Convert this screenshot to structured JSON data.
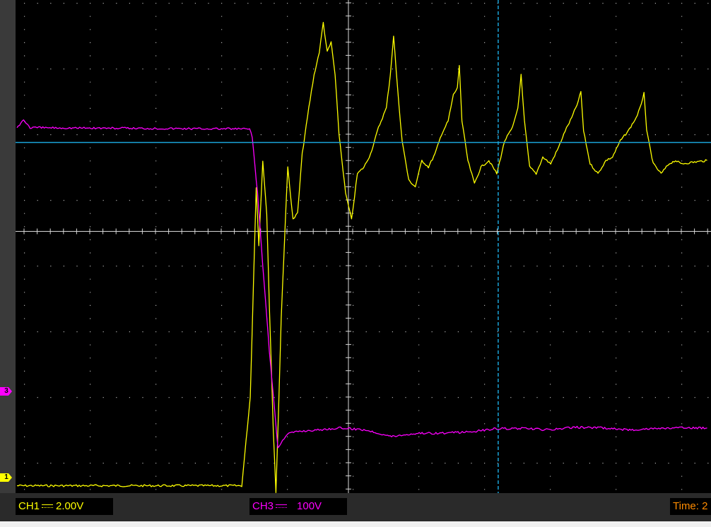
{
  "colors": {
    "ch1": "#ffff00",
    "ch3": "#ff00ff",
    "cursor": "#1aa3d9",
    "time_text": "#ff8c00",
    "grid": "#c8c8c8"
  },
  "channels": [
    {
      "marker": "1",
      "label": "CH1",
      "coupling_icon": "dc-coupling-icon",
      "scale": "2.00V"
    },
    {
      "marker": "3",
      "label": "CH3",
      "coupling_icon": "dc-coupling-icon",
      "scale": "100V"
    }
  ],
  "time_readout": "Time: 2",
  "display": {
    "divisions_x": 10.5,
    "divisions_y": 7.5,
    "cursor_vertical_div": 7.3,
    "cursor_horizontal_div": 2.2
  },
  "chart_data": {
    "type": "line",
    "grid": true,
    "series": [
      {
        "name": "CH1",
        "points": [
          [
            0,
            7.35
          ],
          [
            3.42,
            7.35
          ],
          [
            3.55,
            6.0
          ],
          [
            3.6,
            4.2
          ],
          [
            3.64,
            2.8
          ],
          [
            3.68,
            3.7
          ],
          [
            3.74,
            2.4
          ],
          [
            3.8,
            3.2
          ],
          [
            3.84,
            4.6
          ],
          [
            3.9,
            6.5
          ],
          [
            3.94,
            7.45
          ],
          [
            3.98,
            6.2
          ],
          [
            4.02,
            4.8
          ],
          [
            4.08,
            3.4
          ],
          [
            4.12,
            2.5
          ],
          [
            4.2,
            3.3
          ],
          [
            4.27,
            3.2
          ],
          [
            4.34,
            2.3
          ],
          [
            4.44,
            1.6
          ],
          [
            4.52,
            1.1
          ],
          [
            4.6,
            0.75
          ],
          [
            4.66,
            0.3
          ],
          [
            4.72,
            0.75
          ],
          [
            4.78,
            0.6
          ],
          [
            4.84,
            1.1
          ],
          [
            4.9,
            2.0
          ],
          [
            5.0,
            2.9
          ],
          [
            5.09,
            3.3
          ],
          [
            5.18,
            2.6
          ],
          [
            5.28,
            2.5
          ],
          [
            5.38,
            2.3
          ],
          [
            5.5,
            1.9
          ],
          [
            5.62,
            1.6
          ],
          [
            5.68,
            1.1
          ],
          [
            5.73,
            0.5
          ],
          [
            5.79,
            1.3
          ],
          [
            5.86,
            2.1
          ],
          [
            5.96,
            2.7
          ],
          [
            6.06,
            2.8
          ],
          [
            6.16,
            2.4
          ],
          [
            6.26,
            2.5
          ],
          [
            6.36,
            2.3
          ],
          [
            6.46,
            2.0
          ],
          [
            6.56,
            1.8
          ],
          [
            6.64,
            1.4
          ],
          [
            6.7,
            1.3
          ],
          [
            6.73,
            0.95
          ],
          [
            6.77,
            1.8
          ],
          [
            6.86,
            2.4
          ],
          [
            6.96,
            2.75
          ],
          [
            7.06,
            2.5
          ],
          [
            7.18,
            2.4
          ],
          [
            7.3,
            2.6
          ],
          [
            7.42,
            2.1
          ],
          [
            7.54,
            1.9
          ],
          [
            7.62,
            1.6
          ],
          [
            7.67,
            1.1
          ],
          [
            7.72,
            1.8
          ],
          [
            7.8,
            2.5
          ],
          [
            7.9,
            2.6
          ],
          [
            8.0,
            2.35
          ],
          [
            8.12,
            2.45
          ],
          [
            8.24,
            2.2
          ],
          [
            8.34,
            1.95
          ],
          [
            8.44,
            1.75
          ],
          [
            8.54,
            1.5
          ],
          [
            8.58,
            1.35
          ],
          [
            8.62,
            1.95
          ],
          [
            8.72,
            2.45
          ],
          [
            8.84,
            2.6
          ],
          [
            8.96,
            2.4
          ],
          [
            9.06,
            2.35
          ],
          [
            9.18,
            2.1
          ],
          [
            9.3,
            1.95
          ],
          [
            9.42,
            1.75
          ],
          [
            9.5,
            1.55
          ],
          [
            9.54,
            1.35
          ],
          [
            9.58,
            1.95
          ],
          [
            9.68,
            2.45
          ],
          [
            9.8,
            2.6
          ],
          [
            9.92,
            2.45
          ],
          [
            10.02,
            2.4
          ],
          [
            10.1,
            2.45
          ],
          [
            10.5,
            2.4
          ]
        ]
      },
      {
        "name": "CH3",
        "points": [
          [
            0,
            1.9
          ],
          [
            0.1,
            1.78
          ],
          [
            0.2,
            1.9
          ],
          [
            3.54,
            1.92
          ],
          [
            3.58,
            2.05
          ],
          [
            3.66,
            2.9
          ],
          [
            3.74,
            4.0
          ],
          [
            3.84,
            5.3
          ],
          [
            3.92,
            6.2
          ],
          [
            3.97,
            6.78
          ],
          [
            4.04,
            6.65
          ],
          [
            4.14,
            6.55
          ],
          [
            4.3,
            6.52
          ],
          [
            4.6,
            6.5
          ],
          [
            4.9,
            6.47
          ],
          [
            5.3,
            6.5
          ],
          [
            5.7,
            6.6
          ],
          [
            6.1,
            6.55
          ],
          [
            6.5,
            6.55
          ],
          [
            6.9,
            6.53
          ],
          [
            7.3,
            6.48
          ],
          [
            7.7,
            6.48
          ],
          [
            8.1,
            6.5
          ],
          [
            8.5,
            6.46
          ],
          [
            8.9,
            6.47
          ],
          [
            9.3,
            6.5
          ],
          [
            9.7,
            6.48
          ],
          [
            10.1,
            6.47
          ],
          [
            10.5,
            6.47
          ]
        ]
      }
    ]
  }
}
